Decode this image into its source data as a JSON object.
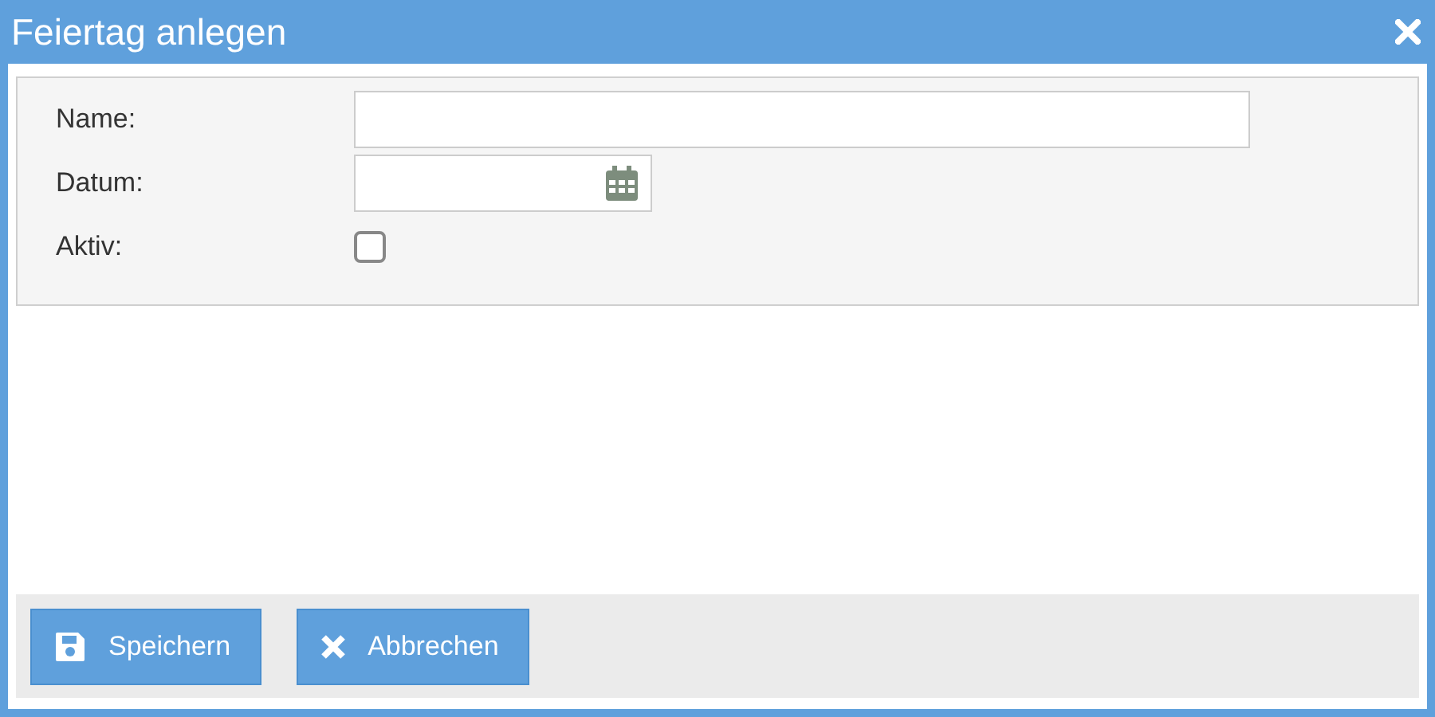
{
  "window": {
    "title": "Feiertag anlegen"
  },
  "fields": [
    {
      "kind": "text",
      "label": "Name:"
    },
    {
      "kind": "date",
      "label": "Datum:"
    },
    {
      "kind": "checkbox",
      "label": "Aktiv:",
      "checked": false
    }
  ],
  "buttons": [
    {
      "kind": "save",
      "label": "Speichern"
    },
    {
      "kind": "cancel",
      "label": "Abbrechen"
    }
  ]
}
